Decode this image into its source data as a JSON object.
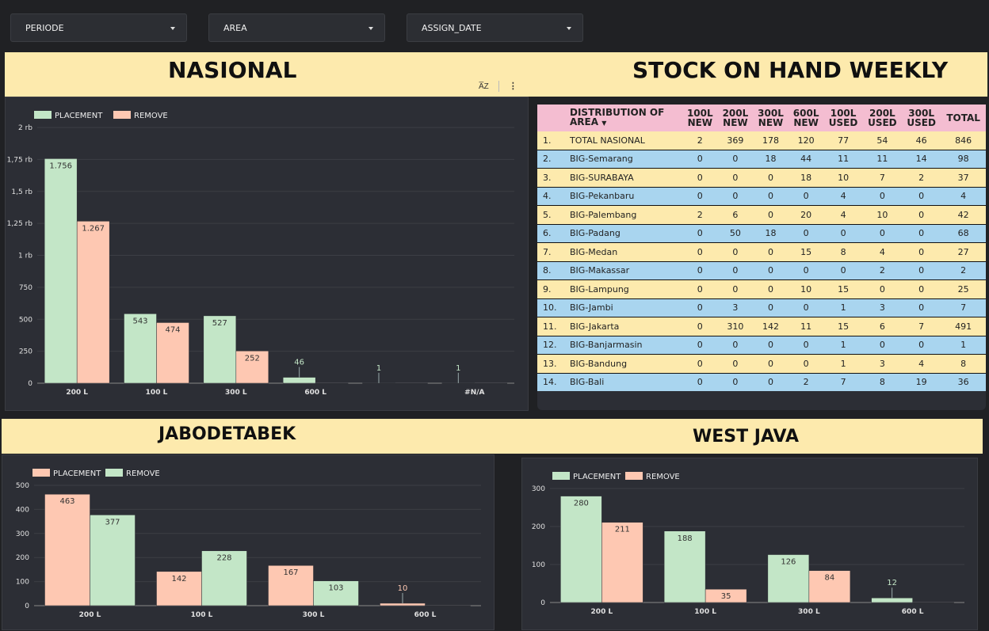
{
  "filters": [
    {
      "label": "PERIODE"
    },
    {
      "label": "AREA"
    },
    {
      "label": "ASSIGN_DATE"
    }
  ],
  "banners": {
    "nasional": "NASIONAL",
    "stock": "STOCK ON HAND WEEKLY",
    "jabodetabek": "JABODETABEK",
    "westjava": "WEST JAVA"
  },
  "toolbar": {
    "sort_icon_text": "A͞Z"
  },
  "table": {
    "headers": {
      "area_line1": "DISTRIBUTION OF",
      "area_line2": "AREA",
      "cols": [
        [
          "100L",
          "NEW"
        ],
        [
          "200L",
          "NEW"
        ],
        [
          "300L",
          "NEW"
        ],
        [
          "600L",
          "NEW"
        ],
        [
          "100L",
          "USED"
        ],
        [
          "200L",
          "USED"
        ],
        [
          "300L",
          "USED"
        ],
        [
          "TOTAL",
          ""
        ]
      ]
    },
    "rows": [
      {
        "no": "1.",
        "area": "TOTAL NASIONAL",
        "v": [
          "2",
          "369",
          "178",
          "120",
          "77",
          "54",
          "46",
          "846"
        ]
      },
      {
        "no": "2.",
        "area": "BIG-Semarang",
        "v": [
          "0",
          "0",
          "18",
          "44",
          "11",
          "11",
          "14",
          "98"
        ]
      },
      {
        "no": "3.",
        "area": "BIG-SURABAYA",
        "v": [
          "0",
          "0",
          "0",
          "18",
          "10",
          "7",
          "2",
          "37"
        ]
      },
      {
        "no": "4.",
        "area": "BIG-Pekanbaru",
        "v": [
          "0",
          "0",
          "0",
          "0",
          "4",
          "0",
          "0",
          "4"
        ]
      },
      {
        "no": "5.",
        "area": "BIG-Palembang",
        "v": [
          "2",
          "6",
          "0",
          "20",
          "4",
          "10",
          "0",
          "42"
        ]
      },
      {
        "no": "6.",
        "area": "BIG-Padang",
        "v": [
          "0",
          "50",
          "18",
          "0",
          "0",
          "0",
          "0",
          "68"
        ]
      },
      {
        "no": "7.",
        "area": "BIG-Medan",
        "v": [
          "0",
          "0",
          "0",
          "15",
          "8",
          "4",
          "0",
          "27"
        ]
      },
      {
        "no": "8.",
        "area": "BIG-Makassar",
        "v": [
          "0",
          "0",
          "0",
          "0",
          "0",
          "2",
          "0",
          "2"
        ]
      },
      {
        "no": "9.",
        "area": "BIG-Lampung",
        "v": [
          "0",
          "0",
          "0",
          "10",
          "15",
          "0",
          "0",
          "25"
        ]
      },
      {
        "no": "10.",
        "area": "BIG-Jambi",
        "v": [
          "0",
          "3",
          "0",
          "0",
          "1",
          "3",
          "0",
          "7"
        ]
      },
      {
        "no": "11.",
        "area": "BIG-Jakarta",
        "v": [
          "0",
          "310",
          "142",
          "11",
          "15",
          "6",
          "7",
          "491"
        ]
      },
      {
        "no": "12.",
        "area": "BIG-Banjarmasin",
        "v": [
          "0",
          "0",
          "0",
          "0",
          "1",
          "0",
          "0",
          "1"
        ]
      },
      {
        "no": "13.",
        "area": "BIG-Bandung",
        "v": [
          "0",
          "0",
          "0",
          "0",
          "1",
          "3",
          "4",
          "8"
        ]
      },
      {
        "no": "14.",
        "area": "BIG-Bali",
        "v": [
          "0",
          "0",
          "0",
          "2",
          "7",
          "8",
          "19",
          "36"
        ]
      }
    ]
  },
  "colors": {
    "green": "#c3e6c7",
    "salmon": "#fec8b2",
    "yellow": "#fdeaad",
    "blue": "#a9d5ef",
    "pink": "#f4bdd1"
  },
  "chart_data": [
    {
      "id": "nasional",
      "type": "bar",
      "categories": [
        "200 L",
        "100 L",
        "300 L",
        "600 L",
        "",
        "#N/A"
      ],
      "series": [
        {
          "name": "PLACEMENT",
          "color": "green",
          "values": [
            1756,
            543,
            527,
            46,
            1,
            1
          ],
          "labels": [
            "1.756",
            "543",
            "527",
            "46",
            "1",
            "1"
          ]
        },
        {
          "name": "REMOVE",
          "color": "salmon",
          "values": [
            1267,
            474,
            252,
            0,
            0,
            0
          ],
          "labels": [
            "1.267",
            "474",
            "252",
            "",
            "",
            ""
          ]
        }
      ],
      "ylim": [
        0,
        2000
      ],
      "yticks": [
        {
          "v": 0,
          "t": "0"
        },
        {
          "v": 250,
          "t": "250"
        },
        {
          "v": 500,
          "t": "500"
        },
        {
          "v": 750,
          "t": "750"
        },
        {
          "v": 1000,
          "t": "1 rb"
        },
        {
          "v": 1250,
          "t": "1,25 rb"
        },
        {
          "v": 1500,
          "t": "1,5 rb"
        },
        {
          "v": 1750,
          "t": "1,75 rb"
        },
        {
          "v": 2000,
          "t": "2 rb"
        }
      ],
      "legend": "top-left"
    },
    {
      "id": "jabodetabek",
      "type": "bar",
      "categories": [
        "200 L",
        "100 L",
        "300 L",
        "600 L"
      ],
      "series": [
        {
          "name": "PLACEMENT",
          "color": "salmon",
          "values": [
            463,
            142,
            167,
            10
          ],
          "labels": [
            "463",
            "142",
            "167",
            "10"
          ]
        },
        {
          "name": "REMOVE",
          "color": "green",
          "values": [
            377,
            228,
            103,
            0
          ],
          "labels": [
            "377",
            "228",
            "103",
            ""
          ]
        }
      ],
      "ylim": [
        0,
        500
      ],
      "yticks": [
        {
          "v": 0,
          "t": "0"
        },
        {
          "v": 100,
          "t": "100"
        },
        {
          "v": 200,
          "t": "200"
        },
        {
          "v": 300,
          "t": "300"
        },
        {
          "v": 400,
          "t": "400"
        },
        {
          "v": 500,
          "t": "500"
        }
      ],
      "legend": "top-left"
    },
    {
      "id": "westjava",
      "type": "bar",
      "categories": [
        "200 L",
        "100 L",
        "300 L",
        "600 L"
      ],
      "series": [
        {
          "name": "PLACEMENT",
          "color": "green",
          "values": [
            280,
            188,
            126,
            12
          ],
          "labels": [
            "280",
            "188",
            "126",
            "12"
          ]
        },
        {
          "name": "REMOVE",
          "color": "salmon",
          "values": [
            211,
            35,
            84,
            0
          ],
          "labels": [
            "211",
            "35",
            "84",
            ""
          ]
        }
      ],
      "ylim": [
        0,
        300
      ],
      "yticks": [
        {
          "v": 0,
          "t": "0"
        },
        {
          "v": 100,
          "t": "100"
        },
        {
          "v": 200,
          "t": "200"
        },
        {
          "v": 300,
          "t": "300"
        }
      ],
      "legend": "top-left"
    }
  ]
}
